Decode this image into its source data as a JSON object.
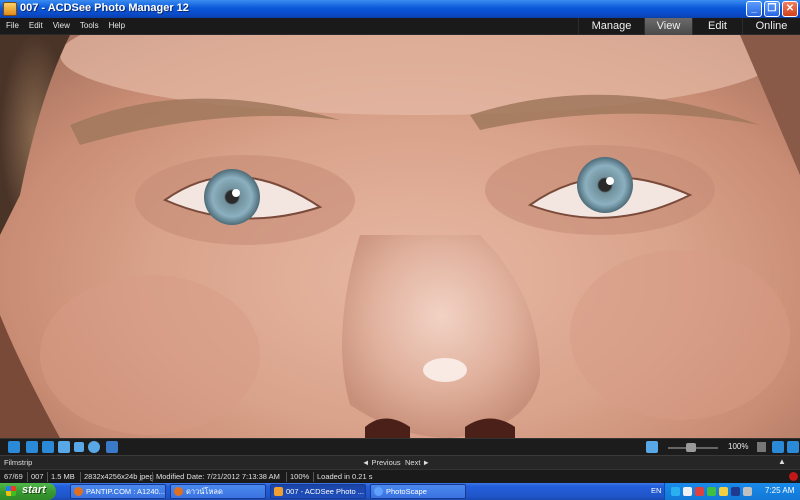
{
  "window": {
    "title": "007 - ACDSee Photo Manager 12",
    "minimize": "_",
    "maximize": "❐",
    "close": "✕"
  },
  "menu": [
    "File",
    "Edit",
    "View",
    "Tools",
    "Help"
  ],
  "modes": [
    {
      "label": "Manage",
      "active": false
    },
    {
      "label": "View",
      "active": true
    },
    {
      "label": "Edit",
      "active": false
    },
    {
      "label": "Online",
      "active": false
    }
  ],
  "viewer": {
    "image": "close-up portrait photo of a face (eyebrows, blue eyes, nose)"
  },
  "toolbar": {
    "zoom": "100%"
  },
  "filmstrip": {
    "label": "Filmstrip",
    "previous": "◄ Previous",
    "next": "Next ►",
    "collapse": "▲"
  },
  "status": {
    "position": "67/69",
    "filename": "007",
    "size": "1.5 MB",
    "dimensions": "2832x4256x24b jpeg",
    "modified": "Modified Date: 7/21/2012 7:13:38 AM",
    "zoom": "100%",
    "loaded": "Loaded in 0.21 s"
  },
  "taskbar": {
    "start": "start",
    "tasks": [
      {
        "label": "PANTIP.COM : A1240...",
        "icon_color": "#e07020",
        "active": false
      },
      {
        "label": "ดาวน์โหลด",
        "icon_color": "#e07020",
        "active": false
      },
      {
        "label": "007 - ACDSee Photo ...",
        "icon_color": "#f0a030",
        "active": true
      },
      {
        "label": "PhotoScape",
        "icon_color": "#60a0ff",
        "active": false
      }
    ],
    "language": "EN",
    "clock": "7:25 AM"
  },
  "colors": {
    "titlebar": "#0a58d8",
    "dark_chrome": "#1a1a1a",
    "active_mode": "#5a5a5a",
    "skin": "#d9a28a",
    "iris": "#7fa6b8",
    "taskbar": "#245edb",
    "start": "#3a9a32"
  }
}
